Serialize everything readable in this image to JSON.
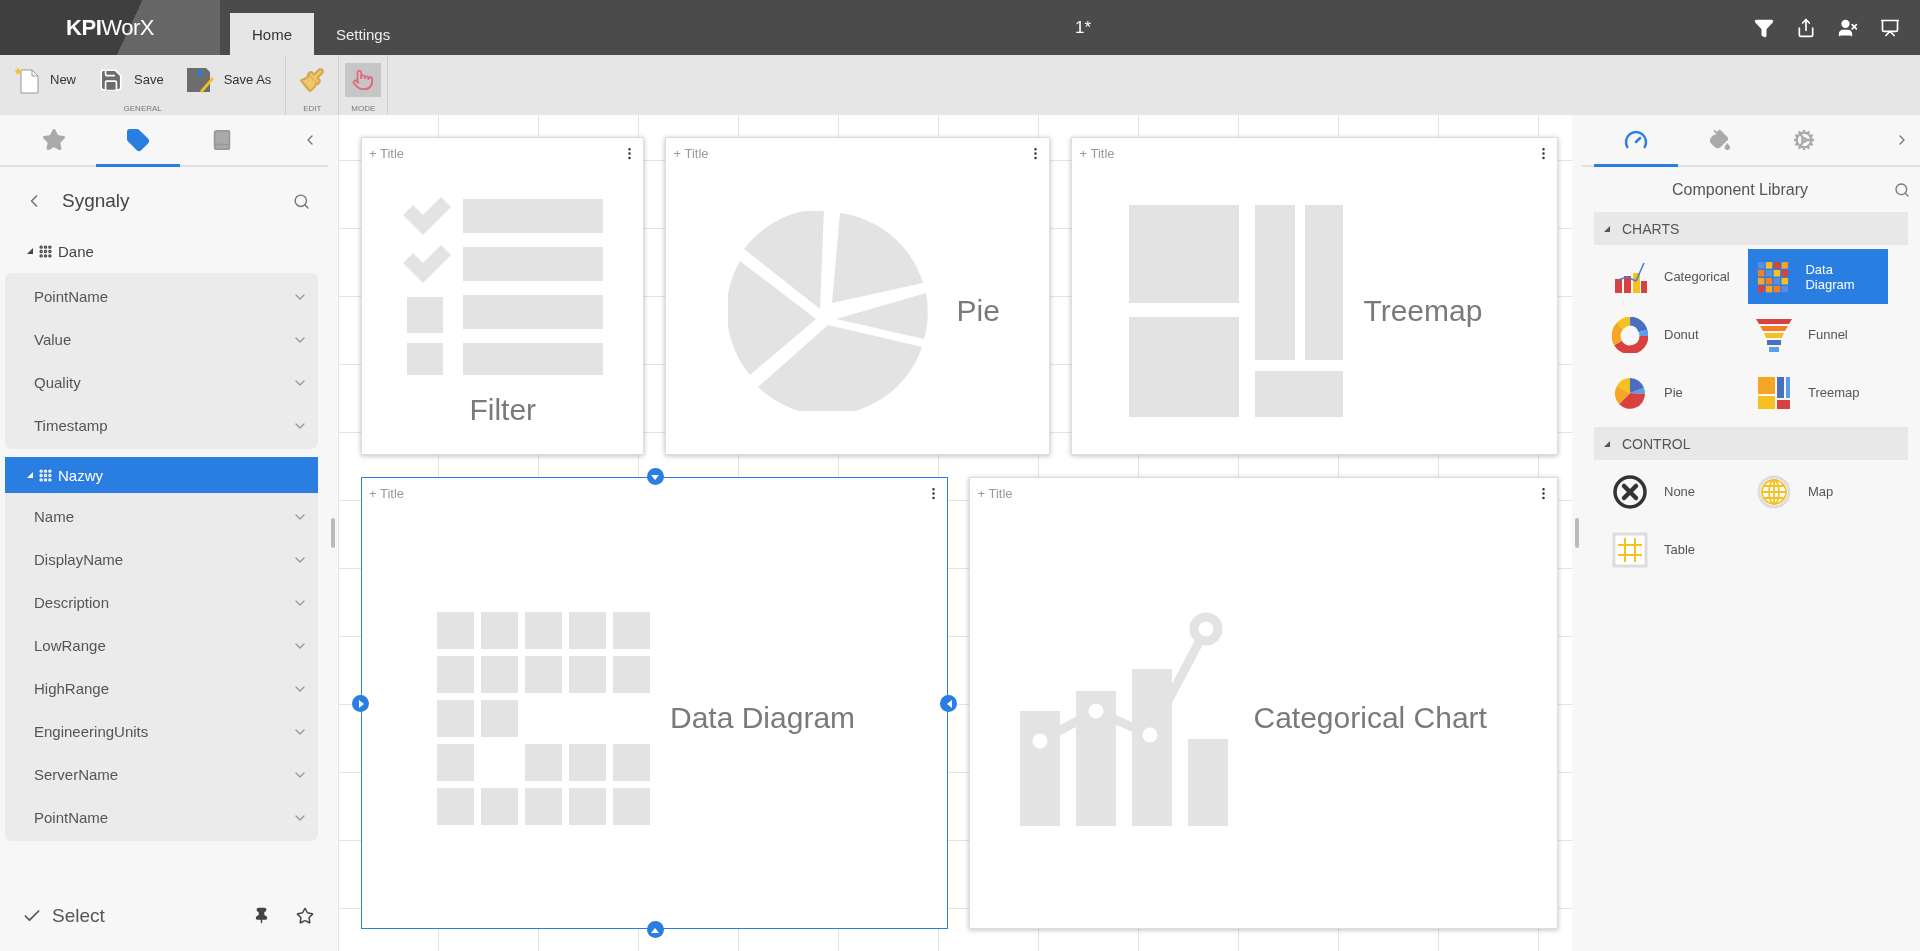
{
  "app": {
    "logo": "**KPI**WorX"
  },
  "menu_tabs": [
    {
      "label": "Home",
      "selected": true
    },
    {
      "label": "Settings",
      "selected": false
    }
  ],
  "document_title": "1*",
  "ribbon": {
    "groups": [
      {
        "label": "GENERAL",
        "buttons": [
          {
            "kind": "new",
            "label": "New",
            "pressed": false
          },
          {
            "kind": "save",
            "label": "Save",
            "pressed": false
          },
          {
            "kind": "save_as",
            "label": "Save As",
            "pressed": false
          }
        ]
      },
      {
        "label": "EDIT",
        "buttons": [
          {
            "kind": "brush",
            "pressed": false
          }
        ]
      },
      {
        "label": "MODE",
        "buttons": [
          {
            "kind": "touch",
            "pressed": true
          }
        ]
      }
    ]
  },
  "left_panel": {
    "tabs": [
      {
        "kind": "favorites",
        "selected": false
      },
      {
        "kind": "tags",
        "selected": true
      },
      {
        "kind": "book",
        "selected": false
      }
    ],
    "title": "Sygnaly",
    "groups": [
      {
        "name": "Dane",
        "selected": false,
        "expanded": true,
        "fields": [
          "PointName",
          "Value",
          "Quality",
          "Timestamp"
        ]
      },
      {
        "name": "Nazwy",
        "selected": true,
        "expanded": true,
        "fields": [
          "Name",
          "DisplayName",
          "Description",
          "LowRange",
          "HighRange",
          "EngineeringUnits",
          "ServerName",
          "PointName"
        ]
      }
    ],
    "footer": {
      "label": "Select"
    }
  },
  "canvas": {
    "rows": [
      {
        "widgets": [
          {
            "kind": "filter",
            "title": "+ Title",
            "label": "Filter",
            "selected": false
          },
          {
            "kind": "pie",
            "title": "+ Title",
            "label": "Pie",
            "selected": false
          },
          {
            "kind": "treemap",
            "title": "+ Title",
            "label": "Treemap",
            "selected": false
          }
        ]
      },
      {
        "widgets": [
          {
            "kind": "data_diagram",
            "title": "+ Title",
            "label": "Data Diagram",
            "selected": true
          },
          {
            "kind": "categorical",
            "title": "+ Title",
            "label": "Categorical Chart",
            "selected": false
          }
        ]
      }
    ]
  },
  "right_panel": {
    "tabs": [
      {
        "kind": "gauge",
        "selected": true
      },
      {
        "kind": "paint",
        "selected": false
      },
      {
        "kind": "gears",
        "selected": false
      }
    ],
    "title": "Component Library",
    "sections": [
      {
        "name": "CHARTS",
        "expanded": true,
        "items": [
          {
            "kind": "categorical",
            "label": "Categorical",
            "selected": false
          },
          {
            "kind": "data_diagram",
            "label": "Data Diagram",
            "selected": true
          },
          {
            "kind": "donut",
            "label": "Donut",
            "selected": false
          },
          {
            "kind": "funnel",
            "label": "Funnel",
            "selected": false
          },
          {
            "kind": "pie",
            "label": "Pie",
            "selected": false
          },
          {
            "kind": "treemap",
            "label": "Treemap",
            "selected": false
          }
        ]
      },
      {
        "name": "CONTROL",
        "expanded": true,
        "items": [
          {
            "kind": "none",
            "label": "None",
            "selected": false
          },
          {
            "kind": "map",
            "label": "Map",
            "selected": false
          },
          {
            "kind": "table",
            "label": "Table",
            "selected": false
          }
        ]
      }
    ]
  }
}
